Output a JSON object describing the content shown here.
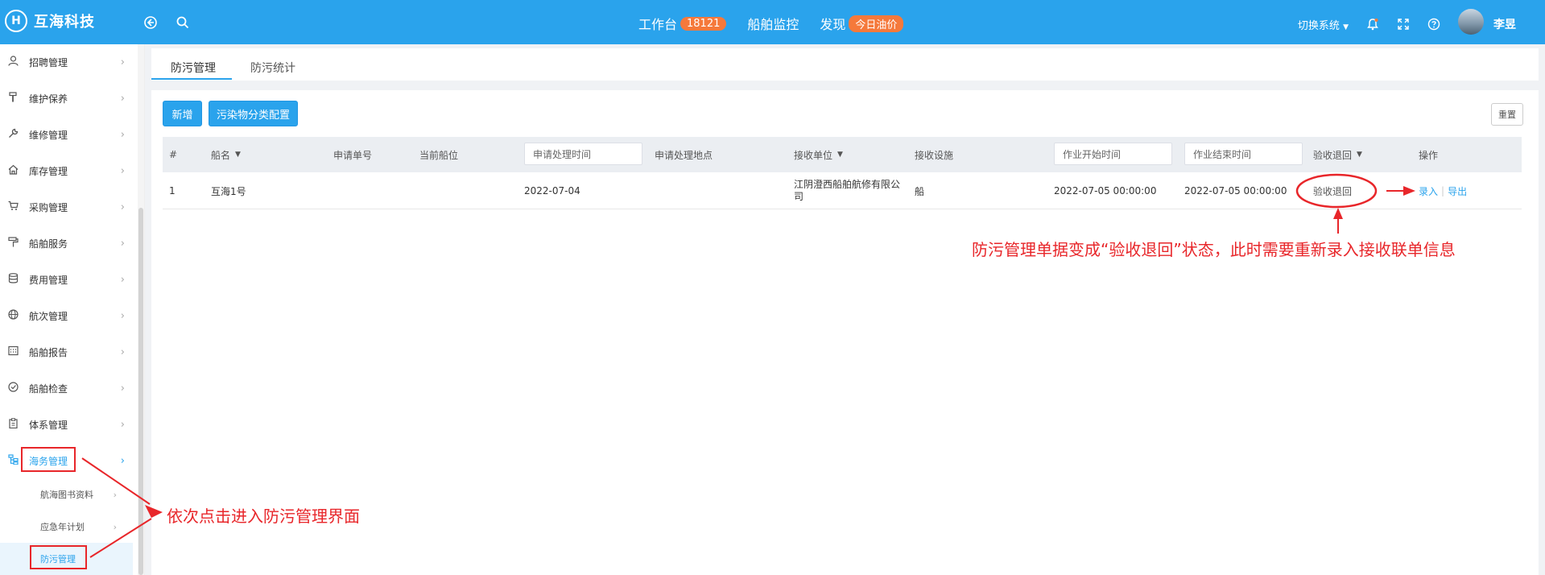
{
  "header": {
    "brand": "互海科技",
    "logo_glyph": "H",
    "nav": [
      {
        "label": "工作台",
        "badge": "18121"
      },
      {
        "label": "船舶监控",
        "badge": ""
      },
      {
        "label": "发现",
        "badge": "今日油价"
      }
    ],
    "switch_system": "切换系统",
    "username": "李昱",
    "icons": [
      "back-circle-icon",
      "search-icon",
      "bell-icon",
      "fullscreen-icon",
      "help-icon"
    ]
  },
  "sidebar": {
    "items": [
      {
        "icon": "user-icon",
        "label": "招聘管理"
      },
      {
        "icon": "hammer-icon",
        "label": "维护保养"
      },
      {
        "icon": "wrench-icon",
        "label": "维修管理"
      },
      {
        "icon": "home-icon",
        "label": "库存管理"
      },
      {
        "icon": "cart-icon",
        "label": "采购管理"
      },
      {
        "icon": "paint-roller-icon",
        "label": "船舶服务"
      },
      {
        "icon": "database-icon",
        "label": "费用管理"
      },
      {
        "icon": "globe-icon",
        "label": "航次管理"
      },
      {
        "icon": "calendar-icon",
        "label": "船舶报告"
      },
      {
        "icon": "check-circle-icon",
        "label": "船舶检查"
      },
      {
        "icon": "clipboard-icon",
        "label": "体系管理"
      },
      {
        "icon": "sitemap-icon",
        "label": "海务管理"
      }
    ],
    "sub_items": [
      {
        "label": "航海图书资料"
      },
      {
        "label": "应急年计划"
      },
      {
        "label": "防污管理"
      }
    ]
  },
  "tabs": [
    {
      "label": "防污管理"
    },
    {
      "label": "防污统计"
    }
  ],
  "toolbar": {
    "add_label": "新增",
    "config_label": "污染物分类配置",
    "reset_label": "重置"
  },
  "table": {
    "headers": {
      "index": "#",
      "ship": "船名",
      "apply_no": "申请单号",
      "berth": "当前船位",
      "apply_time_placeholder": "申请处理时间",
      "apply_place": "申请处理地点",
      "receiver": "接收单位",
      "facility": "接收设施",
      "start_placeholder": "作业开始时间",
      "end_placeholder": "作业结束时间",
      "status": "验收退回",
      "ops": "操作"
    },
    "rows": [
      {
        "index": "1",
        "ship": "互海1号",
        "apply_no": "",
        "berth": "",
        "apply_time": "2022-07-04",
        "apply_place": "",
        "receiver": "江阴澄西船舶航修有限公司",
        "facility": "船",
        "start": "2022-07-05 00:00:00",
        "end": "2022-07-05 00:00:00",
        "status": "验收退回",
        "op_enter": "录入",
        "op_export": "导出"
      }
    ]
  },
  "annotations": {
    "status_note": "防污管理单据变成“验收退回”状态，此时需要重新录入接收联单信息",
    "nav_note": "依次点击进入防污管理界面",
    "color": "#e8262a"
  },
  "colors": {
    "primary": "#2aa3ec",
    "badge": "#f5793b"
  }
}
